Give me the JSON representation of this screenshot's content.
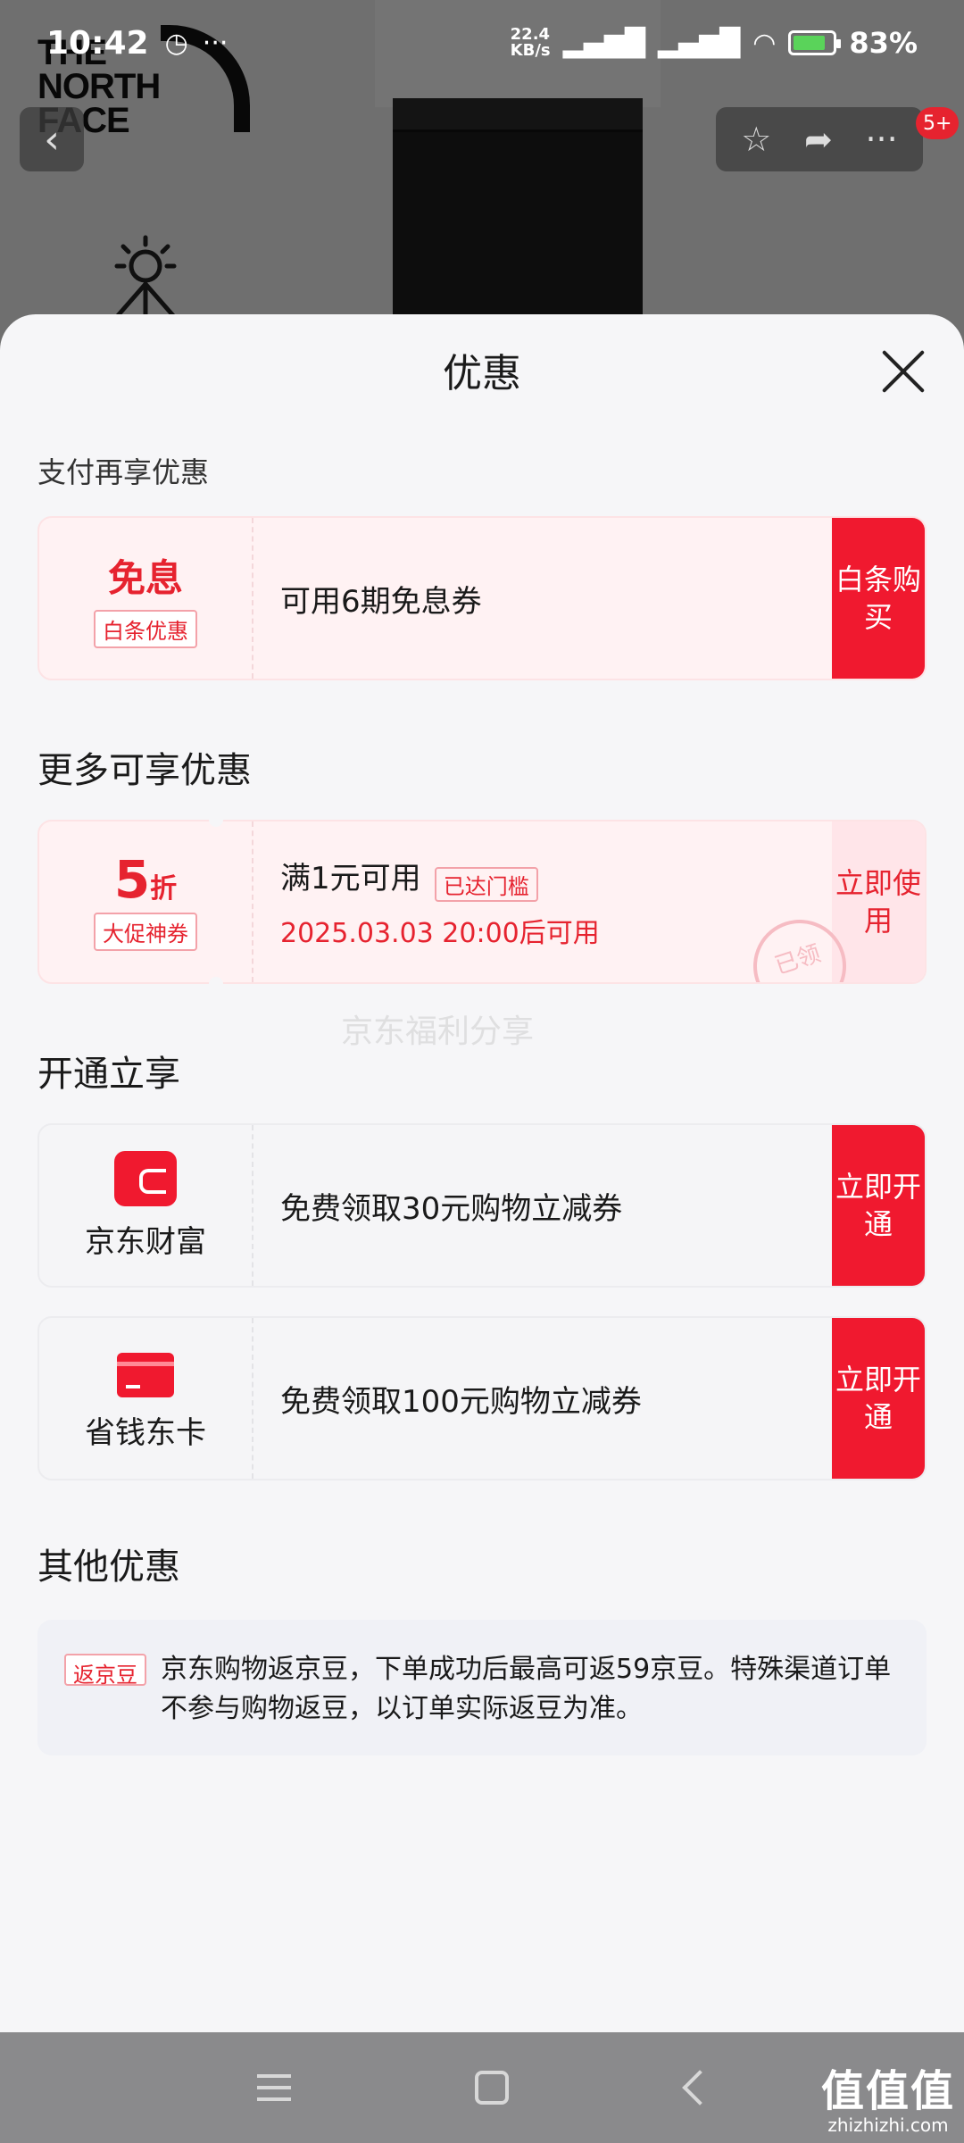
{
  "status_bar": {
    "time": "10:42",
    "network_speed_value": "22.4",
    "network_speed_unit": "KB/s",
    "battery_text": "83%",
    "battery_level": 0.83
  },
  "background": {
    "brand_logo": "THE NORTH FACE",
    "cart_badge": "5+"
  },
  "sheet": {
    "title": "优惠",
    "section_pay": {
      "title": "支付再享优惠",
      "card": {
        "left_main": "免息",
        "left_tag": "白条优惠",
        "text": "可用6期免息券",
        "action_label": "白条购买"
      }
    },
    "section_more": {
      "title": "更多可享优惠",
      "card": {
        "discount_value": "5",
        "discount_unit": "折",
        "left_tag": "大促神券",
        "text": "满1元可用",
        "inline_tag": "已达门槛",
        "subtext": "2025.03.03 20:00后可用",
        "action_label": "立即使用",
        "stamp": "已领"
      }
    },
    "section_open": {
      "title": "开通立享",
      "cards": [
        {
          "name": "京东财富",
          "text": "免费领取30元购物立减券",
          "action_label": "立即开通"
        },
        {
          "name": "省钱东卡",
          "text": "免费领取100元购物立减券",
          "action_label": "立即开通"
        }
      ]
    },
    "section_other": {
      "title": "其他优惠",
      "tag": "返京豆",
      "text": "京东购物返京豆，下单成功后最高可返59京豆。特殊渠道订单不参与购物返豆，以订单实际返豆为准。"
    }
  },
  "watermark_text": "京东福利分享",
  "site_watermark": {
    "main": "值值值",
    "sub": "zhizhizhi.com"
  },
  "colors": {
    "accent_red": "#f0192f",
    "text_red": "#e6232f",
    "sheet_bg": "#f6f6f8"
  }
}
